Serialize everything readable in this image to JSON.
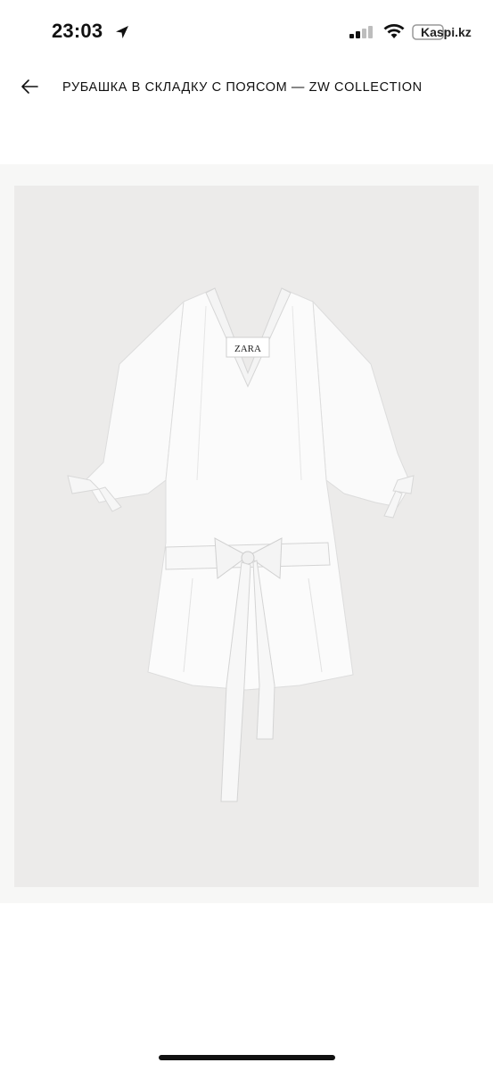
{
  "status_bar": {
    "time": "23:03",
    "back_app": "Kaspi.kz",
    "icons": [
      "location-arrow-icon",
      "cellular-signal-icon",
      "wifi-icon",
      "battery-icon"
    ]
  },
  "header": {
    "title": "РУБАШКА В СКЛАДКУ С ПОЯСОМ — ZW COLLECTION",
    "back_icon": "arrow-left-icon"
  },
  "product_image": {
    "brand_label": "ZARA"
  },
  "colors": {
    "background": "#ffffff",
    "image_background": "#ecebea",
    "text": "#111111"
  }
}
